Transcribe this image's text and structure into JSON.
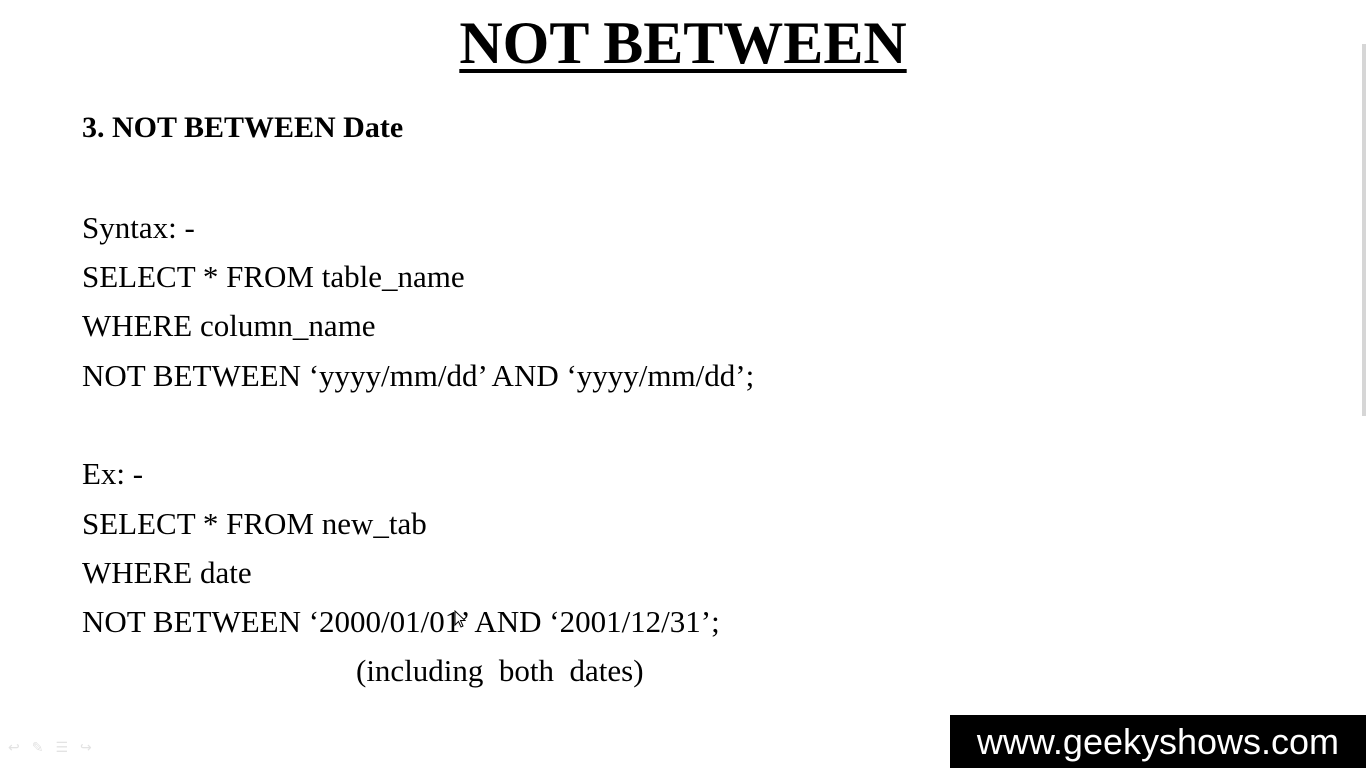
{
  "slide": {
    "title": "NOT BETWEEN",
    "heading": "3. NOT BETWEEN Date",
    "syntax": {
      "label": "Syntax: -",
      "lines": [
        "SELECT * FROM table_name",
        "WHERE column_name",
        "NOT BETWEEN ‘yyyy/mm/dd’ AND ‘yyyy/mm/dd’;"
      ]
    },
    "example": {
      "label": "Ex: -",
      "lines": [
        "SELECT * FROM new_tab",
        "WHERE date",
        "NOT BETWEEN ‘2000/01/01’ AND ‘2001/12/31’;"
      ],
      "note": "(including  both  dates)"
    }
  },
  "watermark": {
    "text": "www.geekyshows.com"
  },
  "icons": {
    "nav": [
      "previous-arrow-icon",
      "pen-icon",
      "menu-icon",
      "next-arrow-icon"
    ],
    "cursor": "mouse-pointer-icon"
  },
  "colors": {
    "background": "#ffffff",
    "text": "#000000",
    "watermark_bg": "#000000",
    "watermark_text": "#ffffff"
  }
}
